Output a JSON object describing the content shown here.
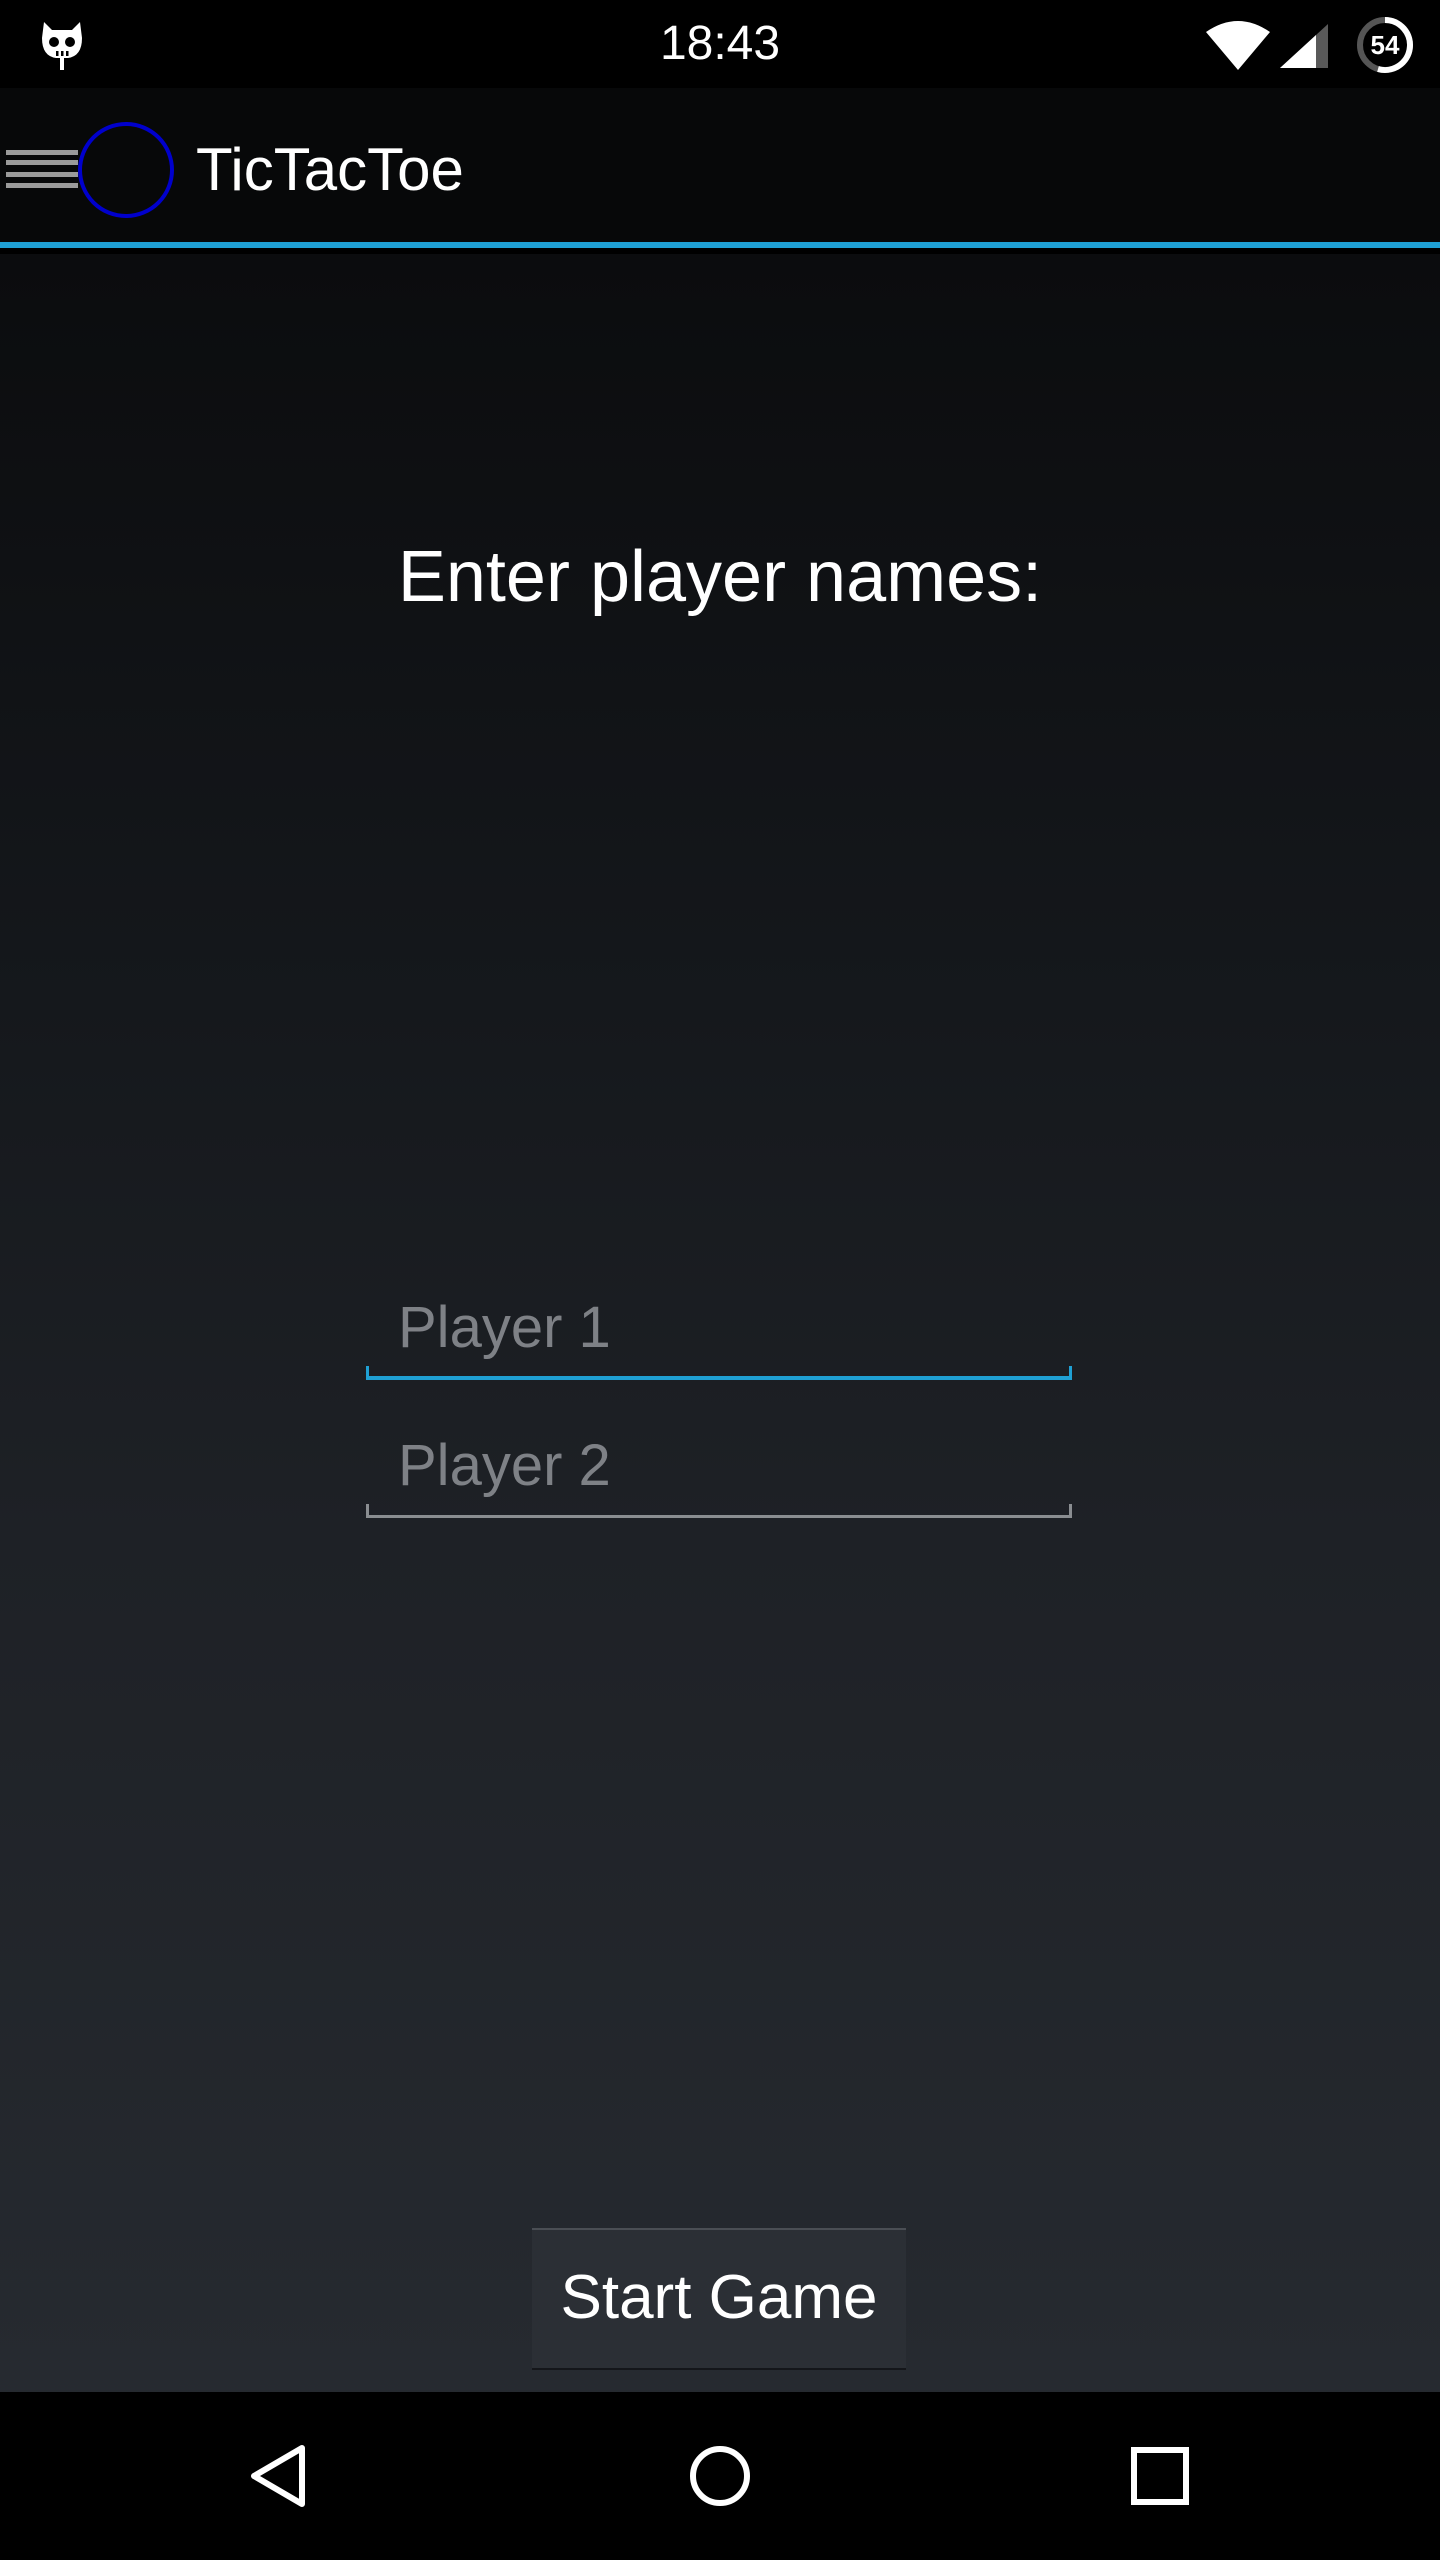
{
  "status_bar": {
    "time": "18:43",
    "battery_level": "54",
    "icons": [
      "cyanogenmod-icon",
      "wifi-icon",
      "cell-signal-icon",
      "battery-icon"
    ]
  },
  "app_bar": {
    "title": "TicTacToe",
    "accent_color": "#1fa0d4",
    "logo_ring_color": "#0000cc"
  },
  "main": {
    "prompt": "Enter player names:",
    "player1": {
      "placeholder": "Player 1",
      "value": ""
    },
    "player2": {
      "placeholder": "Player 2",
      "value": ""
    },
    "start_button_label": "Start Game"
  },
  "nav_bar": {
    "icons": [
      "back-icon",
      "home-icon",
      "recents-icon"
    ]
  }
}
